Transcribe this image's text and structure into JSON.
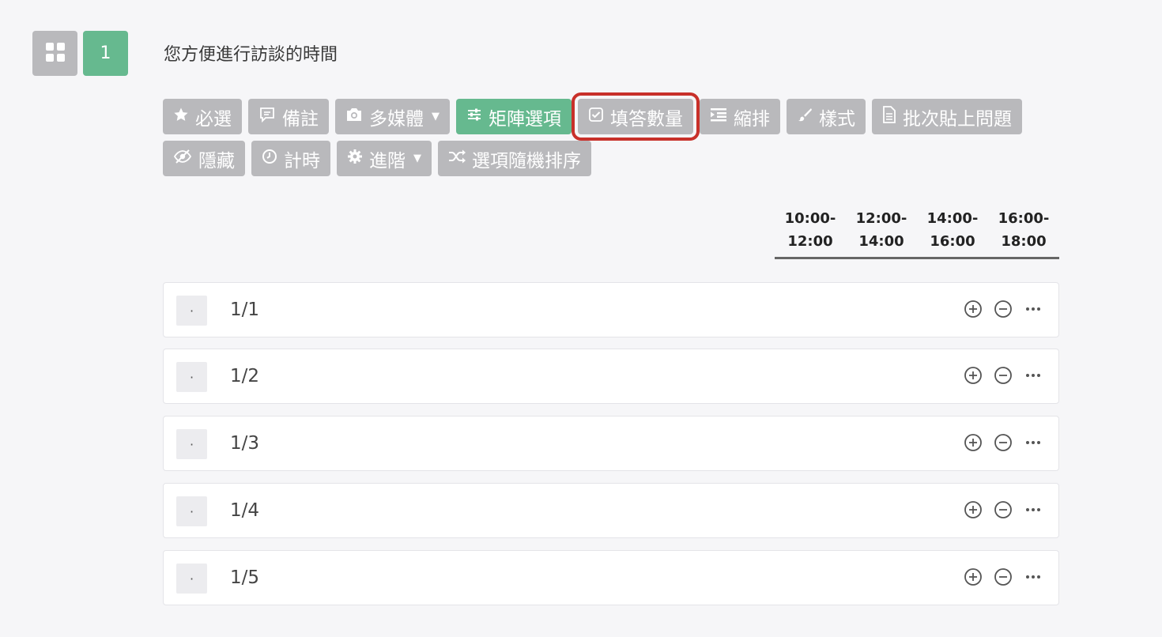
{
  "question": {
    "number": "1",
    "title": "您方便進行訪談的時間"
  },
  "toolbar": {
    "row1": [
      {
        "label": "必選",
        "icon": "star-icon"
      },
      {
        "label": "備註",
        "icon": "comment-icon"
      },
      {
        "label": "多媒體",
        "icon": "camera-icon",
        "dropdown": true
      },
      {
        "label": "矩陣選項",
        "icon": "sliders-icon",
        "active": true
      },
      {
        "label": "填答數量",
        "icon": "checkbox-icon",
        "highlighted": true
      },
      {
        "label": "縮排",
        "icon": "indent-icon"
      },
      {
        "label": "樣式",
        "icon": "brush-icon"
      },
      {
        "label": "批次貼上問題",
        "icon": "document-icon"
      }
    ],
    "row2": [
      {
        "label": "隱藏",
        "icon": "eye-slash-icon"
      },
      {
        "label": "計時",
        "icon": "clock-icon"
      },
      {
        "label": "進階",
        "icon": "gear-icon",
        "dropdown": true
      },
      {
        "label": "選項隨機排序",
        "icon": "shuffle-icon"
      }
    ]
  },
  "columns": [
    {
      "line1": "10:00-",
      "line2": "12:00"
    },
    {
      "line1": "12:00-",
      "line2": "14:00"
    },
    {
      "line1": "14:00-",
      "line2": "16:00"
    },
    {
      "line1": "16:00-",
      "line2": "18:00"
    }
  ],
  "rows": [
    {
      "handle": "·",
      "label": "1/1"
    },
    {
      "handle": "·",
      "label": "1/2"
    },
    {
      "handle": "·",
      "label": "1/3"
    },
    {
      "handle": "·",
      "label": "1/4"
    },
    {
      "handle": "·",
      "label": "1/5"
    }
  ],
  "colors": {
    "button_gray": "#b9b9bc",
    "accent_green": "#66b98f",
    "highlight_red": "#c8302a"
  }
}
